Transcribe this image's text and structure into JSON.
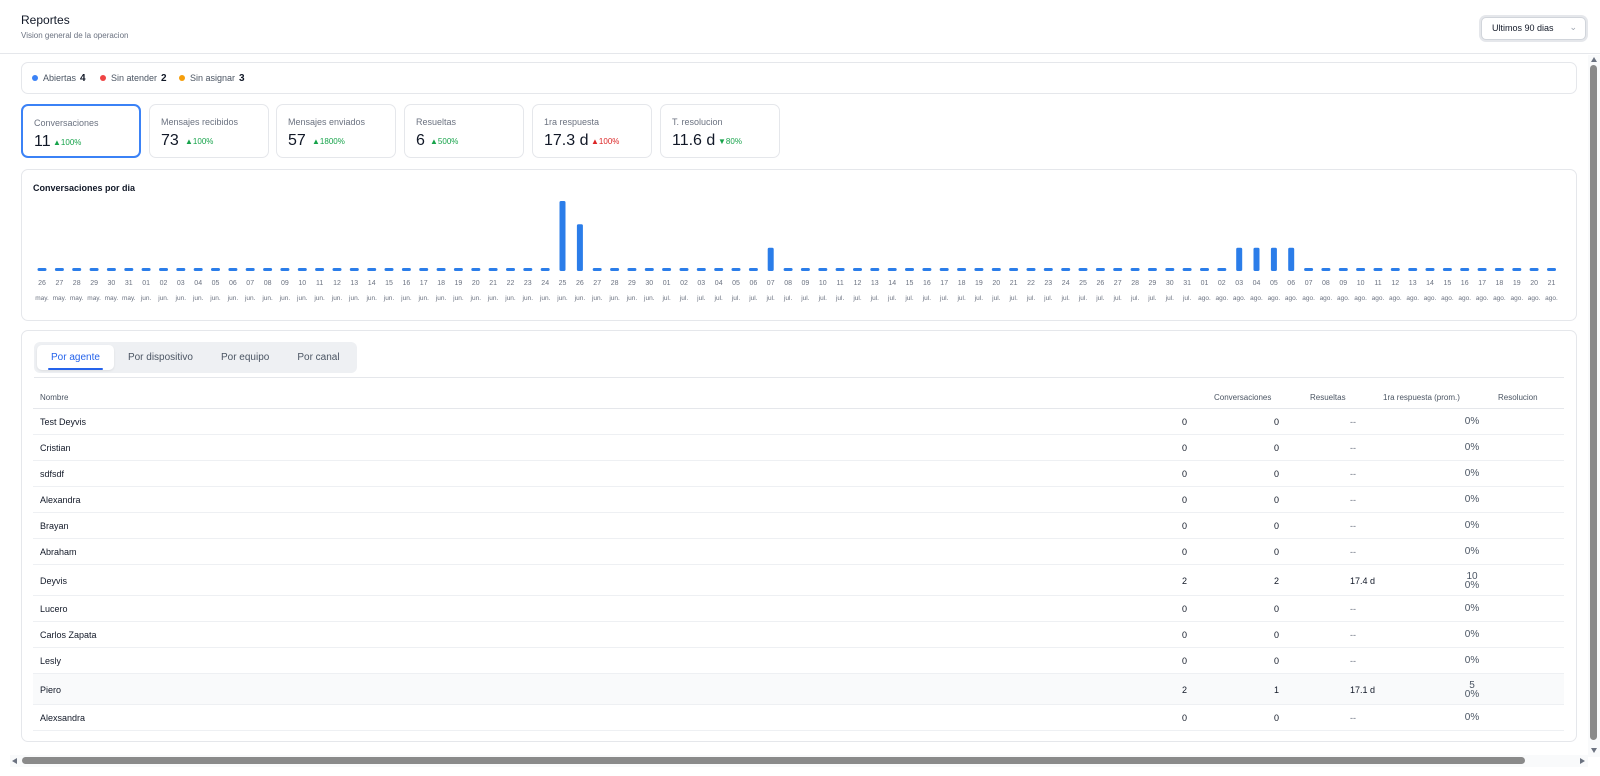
{
  "header": {
    "title": "Reportes",
    "subtitle": "Vision general de la operacion",
    "range_select": "Ultimos 90 dias"
  },
  "status": [
    {
      "label": "Abiertas",
      "count": "4",
      "color": "#3b82f6"
    },
    {
      "label": "Sin atender",
      "count": "2",
      "color": "#ef4444"
    },
    {
      "label": "Sin asignar",
      "count": "3",
      "color": "#f59e0b"
    }
  ],
  "kpis": [
    {
      "label": "Conversaciones",
      "value": "11",
      "delta": "100%",
      "direction": "up"
    },
    {
      "label": "Mensajes recibidos",
      "value": "73",
      "delta": "100%",
      "direction": "up"
    },
    {
      "label": "Mensajes enviados",
      "value": "57",
      "delta": "1800%",
      "direction": "up"
    },
    {
      "label": "Resueltas",
      "value": "6",
      "delta": "500%",
      "direction": "up"
    },
    {
      "label": "1ra respuesta",
      "value": "17.3 d",
      "delta": "100%",
      "direction": "up-bad"
    },
    {
      "label": "T. resolucion",
      "value": "11.6 d",
      "delta": "80%",
      "direction": "down"
    }
  ],
  "chart_data": {
    "type": "bar",
    "title": "Conversaciones por dia",
    "color": "#2b7de9",
    "categories": [
      "26 may.",
      "27 may.",
      "28 may.",
      "29 may.",
      "30 may.",
      "31 may.",
      "01 jun.",
      "02 jun.",
      "03 jun.",
      "04 jun.",
      "05 jun.",
      "06 jun.",
      "07 jun.",
      "08 jun.",
      "09 jun.",
      "10 jun.",
      "11 jun.",
      "12 jun.",
      "13 jun.",
      "14 jun.",
      "15 jun.",
      "16 jun.",
      "17 jun.",
      "18 jun.",
      "19 jun.",
      "20 jun.",
      "21 jun.",
      "22 jun.",
      "23 jun.",
      "24 jun.",
      "25 jun.",
      "26 jun.",
      "27 jun.",
      "28 jun.",
      "29 jun.",
      "30 jun.",
      "01 jul.",
      "02 jul.",
      "03 jul.",
      "04 jul.",
      "05 jul.",
      "06 jul.",
      "07 jul.",
      "08 jul.",
      "09 jul.",
      "10 jul.",
      "11 jul.",
      "12 jul.",
      "13 jul.",
      "14 jul.",
      "15 jul.",
      "16 jul.",
      "17 jul.",
      "18 jul.",
      "19 jul.",
      "20 jul.",
      "21 jul.",
      "22 jul.",
      "23 jul.",
      "24 jul.",
      "25 jul.",
      "26 jul.",
      "27 jul.",
      "28 jul.",
      "29 jul.",
      "30 jul.",
      "31 jul.",
      "01 ago.",
      "02 ago.",
      "03 ago.",
      "04 ago.",
      "05 ago.",
      "06 ago.",
      "07 ago.",
      "08 ago.",
      "09 ago.",
      "10 ago.",
      "11 ago.",
      "12 ago.",
      "13 ago.",
      "14 ago.",
      "15 ago.",
      "16 ago.",
      "17 ago.",
      "18 ago.",
      "19 ago.",
      "20 ago.",
      "21 ago."
    ],
    "values": [
      0,
      0,
      0,
      0,
      0,
      0,
      0,
      0,
      0,
      0,
      0,
      0,
      0,
      0,
      0,
      0,
      0,
      0,
      0,
      0,
      0,
      0,
      0,
      0,
      0,
      0,
      0,
      0,
      0,
      0,
      3,
      2,
      0,
      0,
      0,
      0,
      0,
      0,
      0,
      0,
      0,
      0,
      1,
      0,
      0,
      0,
      0,
      0,
      0,
      0,
      0,
      0,
      0,
      0,
      0,
      0,
      0,
      0,
      0,
      0,
      0,
      0,
      0,
      0,
      0,
      0,
      0,
      0,
      0,
      1,
      1,
      1,
      1,
      0,
      0,
      0,
      0,
      0,
      0,
      0,
      0,
      0,
      0,
      0,
      0,
      0,
      0,
      0
    ],
    "ylim": [
      0,
      3
    ],
    "grid": false,
    "legend": "none"
  },
  "tabs": [
    "Por agente",
    "Por dispositivo",
    "Por equipo",
    "Por canal"
  ],
  "table": {
    "columns": [
      "Nombre",
      "Conversaciones",
      "Resueltas",
      "1ra respuesta (prom.)",
      "Resolucion"
    ],
    "rows": [
      {
        "name": "Test Deyvis",
        "conv": "0",
        "res": "0",
        "first": "--",
        "resol": [
          "0%"
        ]
      },
      {
        "name": "Cristian",
        "conv": "0",
        "res": "0",
        "first": "--",
        "resol": [
          "0%"
        ]
      },
      {
        "name": "sdfsdf",
        "conv": "0",
        "res": "0",
        "first": "--",
        "resol": [
          "0%"
        ]
      },
      {
        "name": "Alexandra",
        "conv": "0",
        "res": "0",
        "first": "--",
        "resol": [
          "0%"
        ]
      },
      {
        "name": "Brayan",
        "conv": "0",
        "res": "0",
        "first": "--",
        "resol": [
          "0%"
        ]
      },
      {
        "name": "Abraham",
        "conv": "0",
        "res": "0",
        "first": "--",
        "resol": [
          "0%"
        ]
      },
      {
        "name": "Deyvis",
        "conv": "2",
        "res": "2",
        "first": "17.4 d",
        "resol": [
          "10",
          "0%"
        ]
      },
      {
        "name": "Lucero",
        "conv": "0",
        "res": "0",
        "first": "--",
        "resol": [
          "0%"
        ]
      },
      {
        "name": "Carlos Zapata",
        "conv": "0",
        "res": "0",
        "first": "--",
        "resol": [
          "0%"
        ]
      },
      {
        "name": "Lesly",
        "conv": "0",
        "res": "0",
        "first": "--",
        "resol": [
          "0%"
        ]
      },
      {
        "name": "Piero",
        "conv": "2",
        "res": "1",
        "first": "17.1 d",
        "resol": [
          "5",
          "0%"
        ]
      },
      {
        "name": "Alexsandra",
        "conv": "0",
        "res": "0",
        "first": "--",
        "resol": [
          "0%"
        ]
      }
    ]
  }
}
